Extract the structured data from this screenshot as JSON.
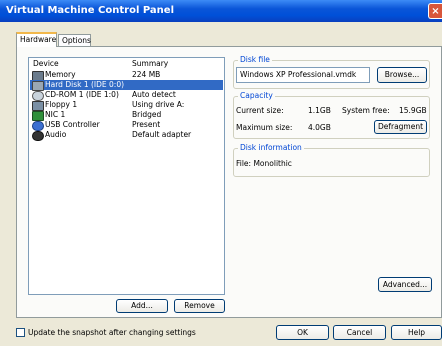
{
  "window": {
    "title": "Virtual Machine Control Panel",
    "close_glyph": "×"
  },
  "tabs": [
    {
      "label": "Hardware"
    },
    {
      "label": "Options"
    }
  ],
  "device_list": {
    "columns": {
      "device": "Device",
      "summary": "Summary"
    },
    "rows": [
      {
        "device": "Memory",
        "summary": "224 MB",
        "icon": "memory-icon"
      },
      {
        "device": "Hard Disk 1 (IDE 0:0)",
        "summary": "",
        "icon": "hard-disk-icon"
      },
      {
        "device": "CD-ROM 1 (IDE 1:0)",
        "summary": "Auto detect",
        "icon": "cdrom-icon"
      },
      {
        "device": "Floppy 1",
        "summary": "Using drive A:",
        "icon": "floppy-icon"
      },
      {
        "device": "NIC 1",
        "summary": "Bridged",
        "icon": "network-icon"
      },
      {
        "device": "USB Controller",
        "summary": "Present",
        "icon": "usb-icon"
      },
      {
        "device": "Audio",
        "summary": "Default adapter",
        "icon": "audio-icon"
      }
    ],
    "selected": "Hard Disk 1 (IDE 0:0)"
  },
  "buttons": {
    "add": "Add...",
    "remove": "Remove",
    "browse": "Browse...",
    "defragment": "Defragment",
    "advanced": "Advanced...",
    "ok": "OK",
    "cancel": "Cancel",
    "help": "Help"
  },
  "disk_file": {
    "label": "Disk file",
    "value": "Windows XP Professional.vmdk"
  },
  "capacity": {
    "label": "Capacity",
    "current_size_label": "Current size:",
    "current_size_value": "1.1GB",
    "system_free_label": "System free:",
    "system_free_value": "15.9GB",
    "maximum_size_label": "Maximum size:",
    "maximum_size_value": "4.0GB"
  },
  "disk_information": {
    "label": "Disk information",
    "file_line": "File:  Monolithic"
  },
  "snapshot_checkbox": {
    "label": "Update the snapshot after changing settings",
    "checked": false
  },
  "colors": {
    "title_bar": "#0a55d8",
    "selection": "#316ac5",
    "group_label": "#0046d5",
    "close_button": "#d8563b"
  }
}
